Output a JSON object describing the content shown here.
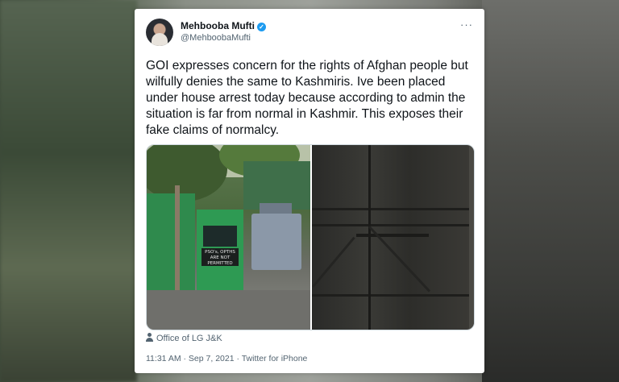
{
  "tweet": {
    "author_name": "Mehbooba Mufti",
    "handle": "@MehboobaMufti",
    "more_label": "···",
    "text": "GOI expresses concern for the rights of Afghan people but wilfully denies the same to Kashmiris. Ive been placed under house arrest today because according to admin the situation is far from normal in Kashmir. This exposes their fake claims of normalcy.",
    "photo_caption": "Office of LG J&K",
    "timestamp": "11:31 AM · Sep 7, 2021 · Twitter for iPhone"
  },
  "photo_left": {
    "sign_text": "PSO's, OPTHS ARE NOT PERMITTED"
  },
  "colors": {
    "verified": "#1d9bf0",
    "text": "#0f1419",
    "secondary": "#536471"
  }
}
